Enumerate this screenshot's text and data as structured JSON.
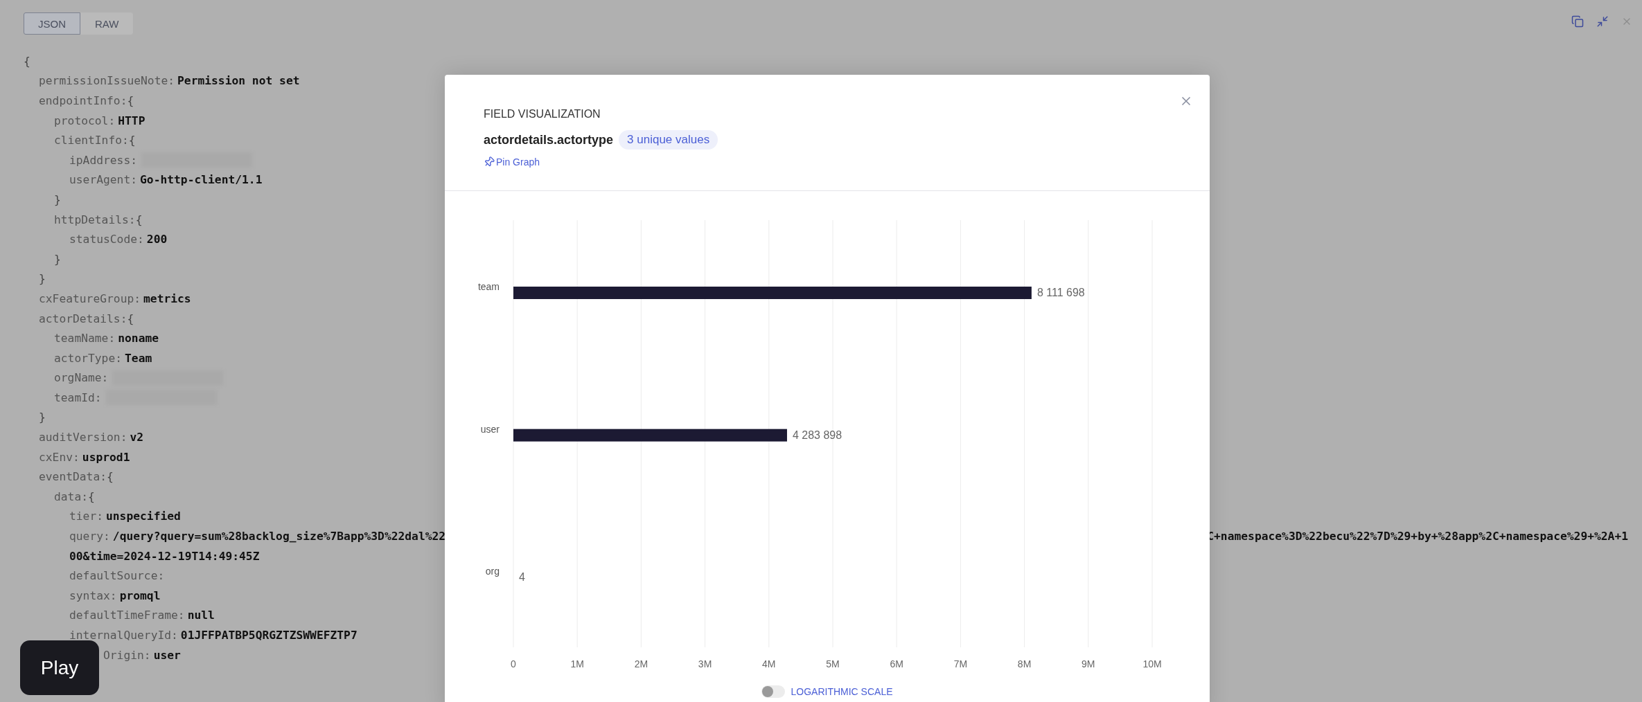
{
  "tabs": [
    {
      "label": "JSON",
      "selected": true
    },
    {
      "label": "RAW",
      "selected": false
    }
  ],
  "document": {
    "open": "{",
    "children": [
      {
        "kind": "value",
        "key": "permissionIssueNote:",
        "value": "Permission not set"
      },
      {
        "kind": "object",
        "key": "endpointInfo:",
        "open": "{",
        "close": "}",
        "children": [
          {
            "kind": "value",
            "key": "protocol:",
            "value": "HTTP"
          },
          {
            "kind": "object",
            "key": "clientInfo:",
            "open": "{",
            "close": "}",
            "children": [
              {
                "kind": "redacted",
                "key": "ipAddress:"
              },
              {
                "kind": "value",
                "key": "userAgent:",
                "value": "Go-http-client/1.1"
              }
            ]
          },
          {
            "kind": "object",
            "key": "httpDetails:",
            "open": "{",
            "close": "}",
            "children": [
              {
                "kind": "value",
                "key": "statusCode:",
                "value": "200"
              }
            ]
          }
        ]
      },
      {
        "kind": "value",
        "key": "cxFeatureGroup:",
        "value": "metrics"
      },
      {
        "kind": "object",
        "key": "actorDetails:",
        "open": "{",
        "close": "}",
        "children": [
          {
            "kind": "value",
            "key": "teamName:",
            "value": "noname"
          },
          {
            "kind": "value",
            "key": "actorType:",
            "value": "Team"
          },
          {
            "kind": "redacted",
            "key": "orgName:"
          },
          {
            "kind": "redacted",
            "key": "teamId:"
          }
        ]
      },
      {
        "kind": "value",
        "key": "auditVersion:",
        "value": "v2"
      },
      {
        "kind": "value",
        "key": "cxEnv:",
        "value": "usprod1"
      },
      {
        "kind": "object",
        "key": "eventData:",
        "open": "{",
        "children": [
          {
            "kind": "object",
            "key": "data:",
            "open": "{",
            "children": [
              {
                "kind": "value",
                "key": "tier:",
                "value": "unspecified"
              },
              {
                "kind": "wrapped",
                "key": "query:",
                "value": "/query?query=sum%28backlog_size%7Bapp%3D%22dal%22",
                "value_end": "C+namespace%3D%22becu%22%7D%29+by+%28app%2C+namespace%29+%2A+1",
                "continuation": "00&time=2024-12-19T14:49:45Z"
              },
              {
                "kind": "empty",
                "key": "defaultSource:"
              },
              {
                "kind": "value",
                "key": "syntax:",
                "value": "promql"
              },
              {
                "kind": "value",
                "key": "defaultTimeFrame:",
                "value": "null"
              },
              {
                "kind": "value",
                "key": "internalQueryId:",
                "value": "01JFFPATBP5QRGZTZSWWEFZTP7"
              },
              {
                "kind": "covered",
                "key": "Origin:",
                "value": "user"
              }
            ]
          }
        ]
      }
    ]
  },
  "play_button": {
    "label": "Play"
  },
  "modal": {
    "eyebrow": "FIELD VISUALIZATION",
    "field": "actordetails.actortype",
    "badge": "3 unique values",
    "pin_link": "Pin Graph",
    "chart_data": {
      "type": "bar",
      "orientation": "horizontal",
      "categories": [
        "team",
        "user",
        "org"
      ],
      "series": [
        {
          "color": "#1c1a33",
          "values": [
            8111698,
            4283898,
            4
          ]
        }
      ],
      "grid": true,
      "value_labels": [
        "8 111 698",
        "4 283 898",
        "4"
      ],
      "xlim": [
        0,
        10000000
      ],
      "xticks": [
        {
          "value": 0,
          "label": "0"
        },
        {
          "value": 1000000,
          "label": "1M"
        },
        {
          "value": 2000000,
          "label": "2M"
        },
        {
          "value": 3000000,
          "label": "3M"
        },
        {
          "value": 4000000,
          "label": "4M"
        },
        {
          "value": 5000000,
          "label": "5M"
        },
        {
          "value": 6000000,
          "label": "6M"
        },
        {
          "value": 7000000,
          "label": "7M"
        },
        {
          "value": 8000000,
          "label": "8M"
        },
        {
          "value": 9000000,
          "label": "9M"
        },
        {
          "value": 10000000,
          "label": "10M"
        }
      ]
    },
    "log_scale": {
      "label": "LOGARITHMIC SCALE",
      "on": false
    }
  }
}
